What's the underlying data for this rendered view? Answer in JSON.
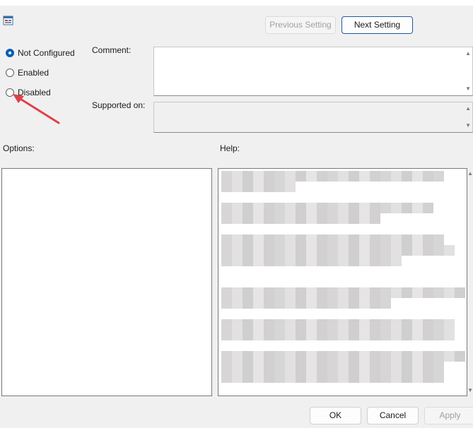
{
  "icons": {
    "title_icon": "policy-settings-icon"
  },
  "navigation": {
    "previous_label": "Previous Setting",
    "next_label": "Next Setting"
  },
  "state": {
    "options": [
      {
        "label": "Not Configured",
        "checked": true
      },
      {
        "label": "Enabled",
        "checked": false
      },
      {
        "label": "Disabled",
        "checked": false
      }
    ]
  },
  "fields": {
    "comment_label": "Comment:",
    "supported_label": "Supported on:"
  },
  "sections": {
    "options_label": "Options:",
    "help_label": "Help:"
  },
  "buttons": {
    "ok": "OK",
    "cancel": "Cancel",
    "apply": "Apply"
  },
  "colors": {
    "accent": "#0a5fb4",
    "annotation_arrow": "#e0404a"
  }
}
